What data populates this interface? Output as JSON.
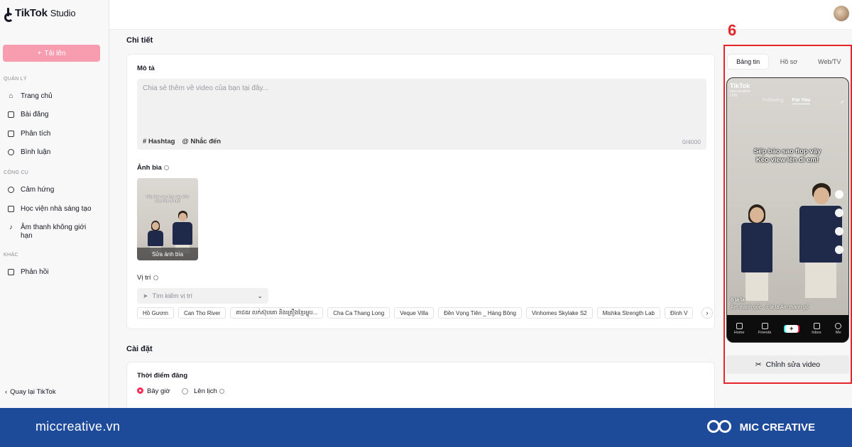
{
  "sidebar": {
    "logo_brand": "TikTok",
    "logo_suffix": "Studio",
    "upload_label": "Tải lên",
    "section_manage": "QUẢN LÝ",
    "section_tools": "CÔNG CỤ",
    "section_other": "KHÁC",
    "items": [
      {
        "label": "Trang chủ",
        "icon": "home-icon"
      },
      {
        "label": "Bài đăng",
        "icon": "posts-icon"
      },
      {
        "label": "Phân tích",
        "icon": "analytics-icon"
      },
      {
        "label": "Bình luận",
        "icon": "comment-icon"
      },
      {
        "label": "Cảm hứng",
        "icon": "lightbulb-icon"
      },
      {
        "label": "Học viện nhà sáng tạo",
        "icon": "book-icon"
      },
      {
        "label": "Âm thanh không giới hạn",
        "icon": "music-note-icon"
      },
      {
        "label": "Phản hồi",
        "icon": "mail-icon"
      }
    ],
    "back_label": "Quay lại TikTok"
  },
  "details": {
    "heading": "Chi tiết",
    "description_label": "Mô tả",
    "description_placeholder": "Chia sẻ thêm về video của bạn tại đây...",
    "description_value": "",
    "hashtag_label": "Hashtag",
    "mention_label": "Nhắc đến",
    "char_count": "0/4000",
    "cover_label": "Ảnh bìa",
    "cover_edit_label": "Sửa ảnh bìa",
    "cover_overlay": "Sếp bảo sao flop vậy Kéo view lên đi em!",
    "location_label": "Vị trí",
    "location_placeholder": "Tìm kiếm vị trí",
    "location_chips": [
      "Hồ Gươm",
      "Can Tho River",
      "គាជឍ លក់ស៊ុបគោ និងគ្រឿងខ្មែរម្ហូប...",
      "Cha Ca Thang Long",
      "Veque Villa",
      "Đền Vọng Tiên _ Hàng Bông",
      "Vinhomes Skylake S2",
      "Mishka Strength Lab",
      "Đình V"
    ]
  },
  "settings": {
    "heading": "Cài đặt",
    "post_time_label": "Thời điểm đăng",
    "option_now": "Bây giờ",
    "option_schedule": "Lên lịch",
    "selected": "now"
  },
  "preview": {
    "step_number": "6",
    "tabs": [
      "Bảng tin",
      "Hồ sơ",
      "Web/TV"
    ],
    "active_tab": 0,
    "phone": {
      "app_name": "TikTok",
      "account": "mic.creative",
      "live": "LIVE",
      "feed_following": "Following",
      "feed_foryou": "For You",
      "overlay_line1": "Sếp bảo sao flop vậy",
      "overlay_line2": "Kéo view lên đi em!",
      "caption_user": "ố là la",
      "caption_sound": "Âm thanh gốc - ố là la   Âm thanh gố",
      "nav": [
        "Home",
        "Friends",
        "",
        "Inbox",
        "Me"
      ]
    },
    "edit_video_label": "Chỉnh sửa video"
  },
  "footer": {
    "website": "miccreative.vn",
    "brand": "MIC CREATIVE"
  },
  "colors": {
    "accent": "#fe2c55",
    "upload_button": "#f89cb0",
    "highlight_border": "#e2262b",
    "footer_bg": "#1e4a9a"
  }
}
